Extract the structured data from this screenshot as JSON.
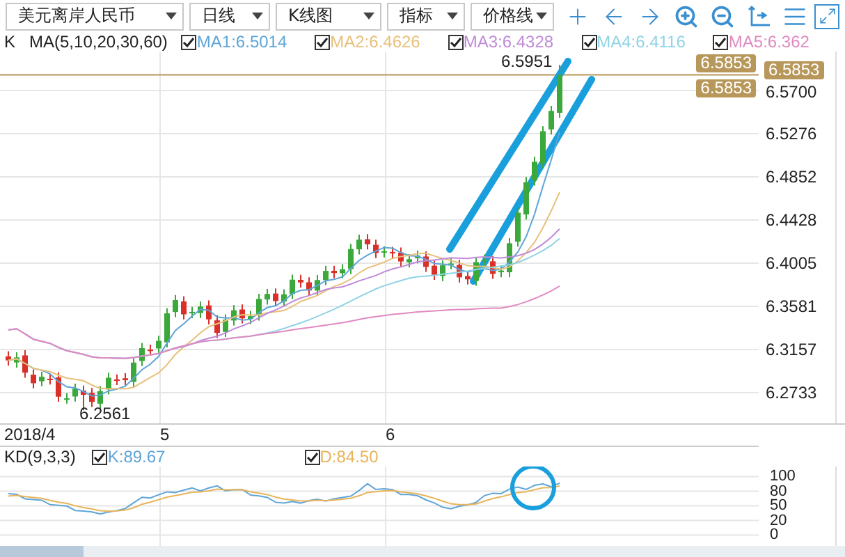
{
  "toolbar": {
    "dropdowns": [
      {
        "label": "美元离岸人民币"
      },
      {
        "label": "日线"
      },
      {
        "label": "K线图"
      },
      {
        "label": "指标"
      },
      {
        "label": "价格线"
      }
    ]
  },
  "legend": {
    "chart_type": "K",
    "ma_params": "MA(5,10,20,30,60)",
    "lines": [
      {
        "label": "MA1:6.5014",
        "checked": true,
        "color": "#5ea5d8"
      },
      {
        "label": "MA2:6.4626",
        "checked": true,
        "color": "#e8c07a"
      },
      {
        "label": "MA3:6.4328",
        "checked": true,
        "color": "#c08ad8"
      },
      {
        "label": "MA4:6.4116",
        "checked": true,
        "color": "#8fd3e6"
      },
      {
        "label": "MA5:6.362",
        "checked": true,
        "color": "#e08ac0"
      }
    ]
  },
  "price_chart": {
    "high_label": "6.5951",
    "low_label": "6.2561",
    "price_tags": [
      "6.5853",
      "6.5853"
    ],
    "axis_tag": "6.5853",
    "axis_labels": [
      "6.5700",
      "6.5276",
      "6.4852",
      "6.4428",
      "6.4005",
      "6.3581",
      "6.3157",
      "6.2733"
    ]
  },
  "date_axis": [
    "2018/4",
    "5",
    "6"
  ],
  "kd": {
    "params": "KD(9,3,3)",
    "lines": [
      {
        "label": "K:89.67",
        "checked": true,
        "color": "#5ea5d8"
      },
      {
        "label": "D:84.50",
        "checked": true,
        "color": "#e8b45a"
      }
    ],
    "axis_labels": [
      "100",
      "80",
      "50",
      "20",
      "0"
    ]
  }
}
